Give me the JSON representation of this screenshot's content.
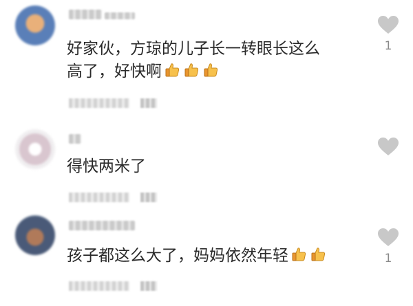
{
  "comments": [
    {
      "text": "好家伙，方琼的儿子长一转眼长这么",
      "text2": "高了，好快啊",
      "emoji_count": 3,
      "like_count": "1"
    },
    {
      "text": "得快两米了",
      "like_count": ""
    },
    {
      "text": "孩子都这么大了，妈妈依然年轻",
      "emoji_count": 2,
      "like_count": "1"
    }
  ],
  "icons": {
    "like": "heart-icon",
    "emoji": "thumbs-up-icon"
  },
  "colors": {
    "heart": "#c8c8c8",
    "text": "#2a2a2a",
    "count": "#8a8a8a"
  }
}
